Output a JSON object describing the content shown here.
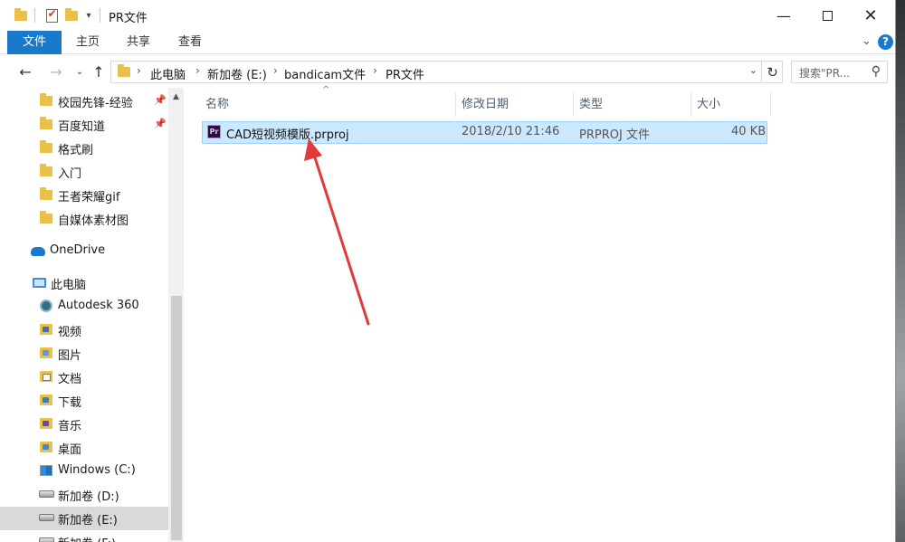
{
  "window": {
    "title": "PR文件"
  },
  "ribbon": {
    "tabs": [
      "文件",
      "主页",
      "共享",
      "查看"
    ]
  },
  "address": {
    "crumbs": [
      "此电脑",
      "新加卷 (E:)",
      "bandicam文件",
      "PR文件"
    ],
    "search_placeholder": "搜索\"PR..."
  },
  "sidebar": {
    "quick_access": [
      {
        "label": "校园先锋-经验",
        "pinned": true
      },
      {
        "label": "百度知道",
        "pinned": true
      },
      {
        "label": "格式刷",
        "pinned": false
      },
      {
        "label": "入门",
        "pinned": false
      },
      {
        "label": "王者荣耀gif",
        "pinned": false
      },
      {
        "label": "自媒体素材图",
        "pinned": false
      }
    ],
    "onedrive": "OneDrive",
    "this_pc": "此电脑",
    "pc_items": [
      {
        "label": "Autodesk 360",
        "icon": "autodesk-360-icon"
      },
      {
        "label": "视频",
        "icon": "videos-folder-icon"
      },
      {
        "label": "图片",
        "icon": "pictures-folder-icon"
      },
      {
        "label": "文档",
        "icon": "documents-folder-icon"
      },
      {
        "label": "下载",
        "icon": "downloads-folder-icon"
      },
      {
        "label": "音乐",
        "icon": "music-folder-icon"
      },
      {
        "label": "桌面",
        "icon": "desktop-folder-icon"
      },
      {
        "label": "Windows (C:)",
        "icon": "windows-drive-icon"
      },
      {
        "label": "新加卷 (D:)",
        "icon": "drive-icon"
      },
      {
        "label": "新加卷 (E:)",
        "icon": "drive-icon",
        "selected": true
      },
      {
        "label": "新加卷 (F:)",
        "icon": "drive-icon"
      }
    ]
  },
  "columns": [
    "名称",
    "修改日期",
    "类型",
    "大小"
  ],
  "files": [
    {
      "name": "CAD短视频模版.prproj",
      "modified": "2018/2/10 21:46",
      "type": "PRPROJ 文件",
      "size": "40 KB",
      "icon": "premiere-project-icon",
      "selected": true
    }
  ],
  "colors": {
    "accent": "#1979ca",
    "selection": "#cce8ff",
    "annotation_arrow": "#e03a3a"
  }
}
